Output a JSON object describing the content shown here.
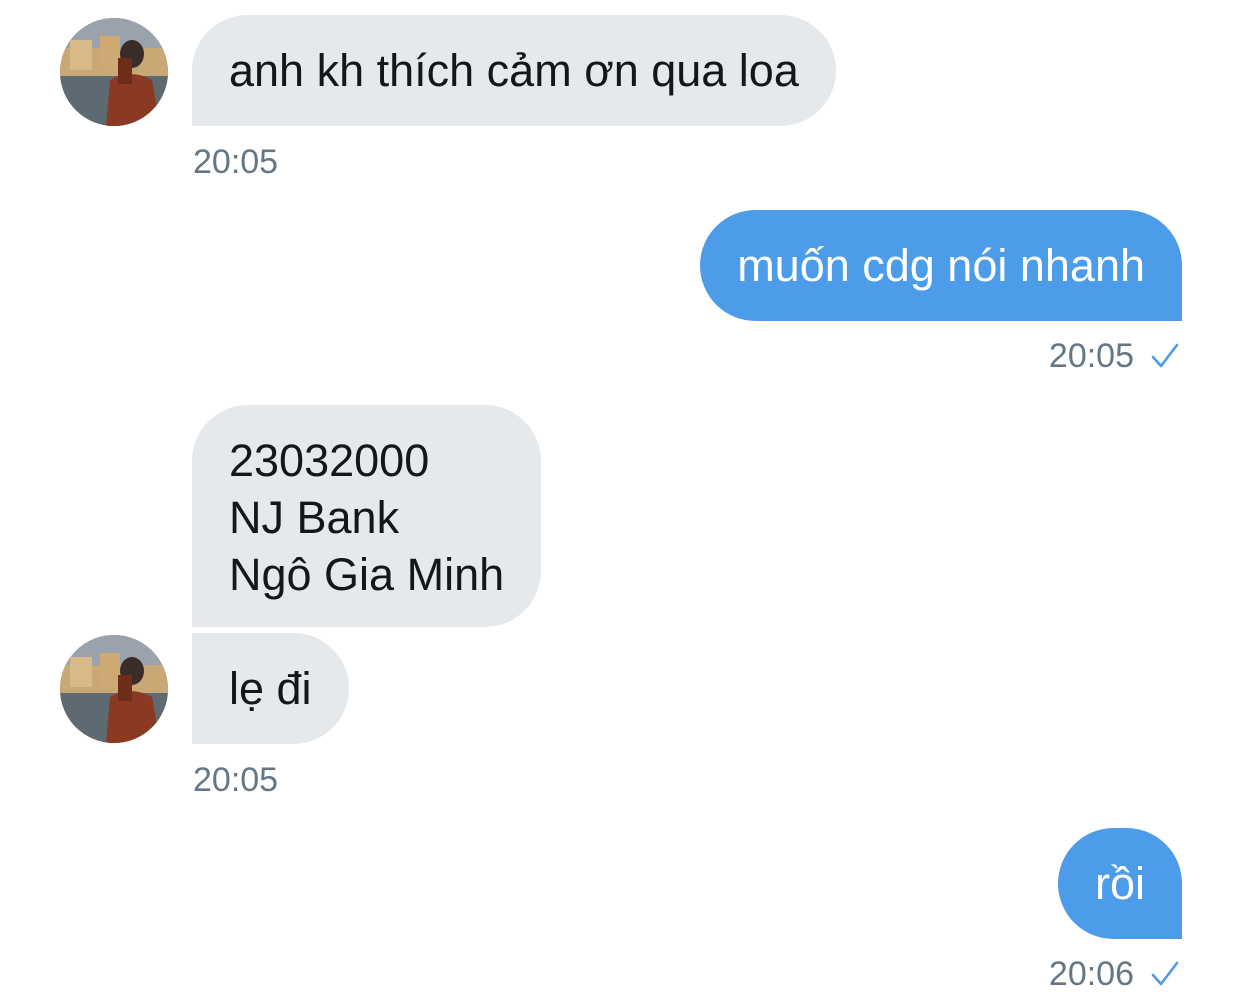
{
  "colors": {
    "incoming_bubble": "#e6e9ec",
    "outgoing_bubble": "#4c9ce9",
    "timestamp": "#657786",
    "check": "#4c9ce9"
  },
  "messages": [
    {
      "direction": "incoming",
      "lines": [
        "anh kh thích cảm ơn qua loa"
      ],
      "time": "20:05",
      "avatar": "user-avatar-photo"
    },
    {
      "direction": "outgoing",
      "lines": [
        "muốn cdg nói nhanh"
      ],
      "time": "20:05",
      "status_icon": "check-icon"
    },
    {
      "direction": "incoming",
      "lines": [
        "23032000",
        "NJ Bank",
        "Ngô Gia Minh"
      ]
    },
    {
      "direction": "incoming",
      "lines": [
        "lẹ đi"
      ],
      "time": "20:05",
      "avatar": "user-avatar-photo"
    },
    {
      "direction": "outgoing",
      "lines": [
        "rồi"
      ],
      "time": "20:06",
      "status_icon": "check-icon"
    }
  ]
}
